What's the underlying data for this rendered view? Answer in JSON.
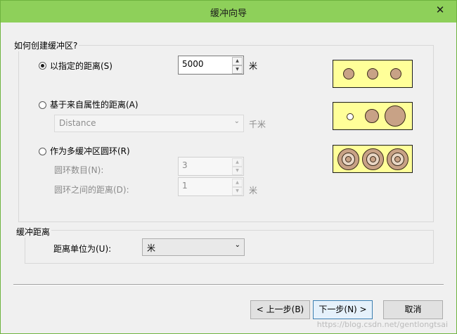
{
  "window": {
    "title": "缓冲向导",
    "close_glyph": "✕"
  },
  "section1": {
    "title": "如何创建缓冲区?",
    "option_distance": {
      "label": "以指定的距离(S)",
      "value": "5000",
      "unit": "米",
      "selected": true
    },
    "option_attribute": {
      "label": "基于来自属性的距离(A)",
      "field_value": "Distance",
      "unit": "千米",
      "selected": false
    },
    "option_rings": {
      "label": "作为多缓冲区圆环(R)",
      "ring_count_label": "圆环数目(N):",
      "ring_count_value": "3",
      "ring_distance_label": "圆环之间的距离(D):",
      "ring_distance_value": "1",
      "unit": "米",
      "selected": false
    }
  },
  "section2": {
    "title": "缓冲距离",
    "unit_label": "距离单位为(U):",
    "unit_value": "米"
  },
  "buttons": {
    "back": "< 上一步(B)",
    "next": "下一步(N) >",
    "cancel": "取消"
  },
  "watermark": "https://blog.csdn.net/gentlongtsai",
  "colors": {
    "titlebar": "#8ed05a",
    "illustration_bg": "#ffff99",
    "buffer_fill": "#c8a286",
    "buffer_ring": "#e8d6c4"
  }
}
